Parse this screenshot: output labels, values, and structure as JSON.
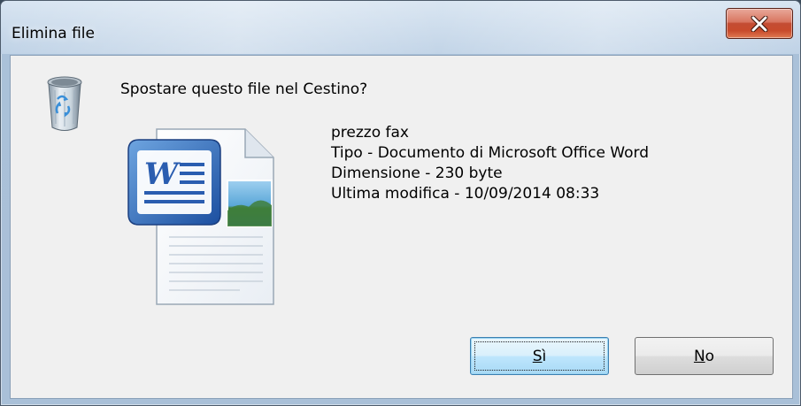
{
  "window": {
    "title": "Elimina file",
    "close_icon": "close-x-icon"
  },
  "dialog": {
    "question": "Spostare questo file nel Cestino?",
    "recycle_icon": "recycle-bin-icon",
    "file_icon": "word-document-icon",
    "file": {
      "name": "prezzo fax",
      "type": "Tipo - Documento di Microsoft Office Word",
      "size": "Dimensione - 230 byte",
      "modified": "Ultima modifica - 10/09/2014 08:33"
    }
  },
  "buttons": {
    "yes": {
      "mnemonic": "S",
      "rest": "ì",
      "label": "Sì"
    },
    "no": {
      "mnemonic": "N",
      "rest": "o",
      "label": "No"
    }
  },
  "colors": {
    "close_button": "#c84b2c",
    "client_background": "#f0f0f0",
    "default_button_border": "#3c7fb1"
  }
}
